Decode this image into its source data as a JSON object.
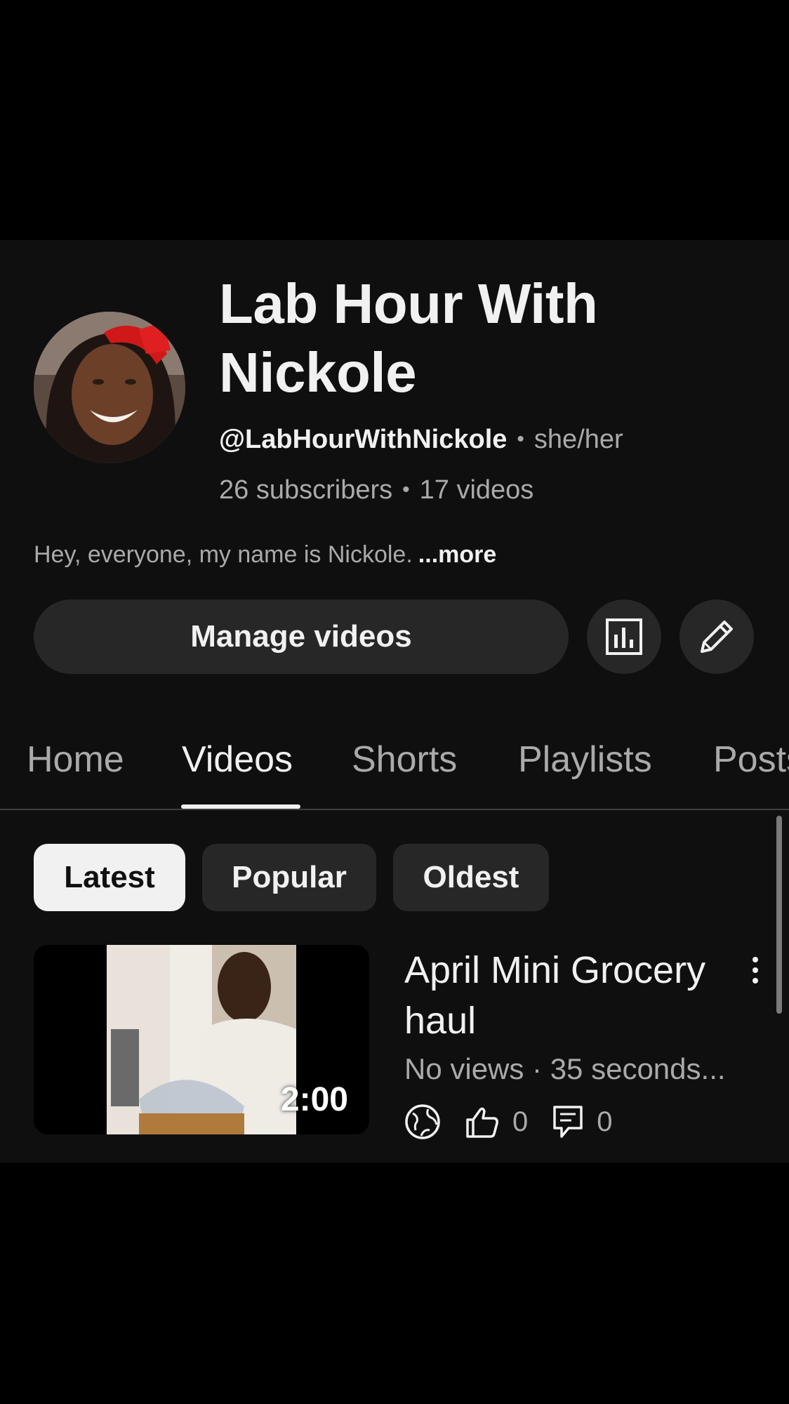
{
  "channel": {
    "title": "Lab Hour With Nickole",
    "handle": "@LabHourWithNickole",
    "pronouns": "she/her",
    "subscribers": "26 subscribers",
    "video_count": "17 videos",
    "description": "Hey, everyone, my name is Nickole.",
    "more_label": "...more"
  },
  "actions": {
    "manage_label": "Manage videos",
    "stats_icon": "bar-chart-icon",
    "edit_icon": "pencil-icon"
  },
  "tabs": [
    {
      "label": "Home",
      "active": false
    },
    {
      "label": "Videos",
      "active": true
    },
    {
      "label": "Shorts",
      "active": false
    },
    {
      "label": "Playlists",
      "active": false
    },
    {
      "label": "Posts",
      "active": false
    }
  ],
  "filters": [
    {
      "label": "Latest",
      "active": true
    },
    {
      "label": "Popular",
      "active": false
    },
    {
      "label": "Oldest",
      "active": false
    }
  ],
  "video": {
    "title": "April Mini Grocery haul",
    "duration": "2:00",
    "meta": "No views · 35 seconds...",
    "likes": "0",
    "comments": "0",
    "visibility_icon": "globe-icon"
  },
  "colors": {
    "background": "#0f0f0f",
    "surface": "#272727",
    "text": "#f1f1f1",
    "muted": "#aaaaaa"
  }
}
